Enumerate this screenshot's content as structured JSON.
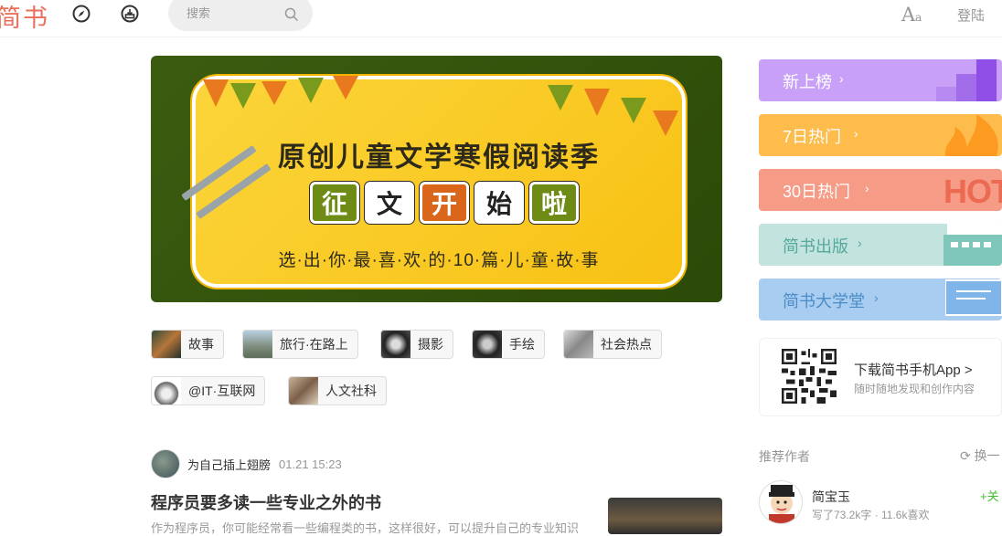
{
  "header": {
    "logo": "简书",
    "search_placeholder": "搜索",
    "font_toggle_big": "A",
    "font_toggle_small": "a",
    "login": "登陆"
  },
  "banner": {
    "title": "原创儿童文学寒假阅读季",
    "tiles": [
      "征",
      "文",
      "开",
      "始",
      "啦"
    ],
    "subtitle": "选·出·你·最·喜·欢·的·10·篇·儿·童·故·事"
  },
  "tags": [
    "故事",
    "旅行·在路上",
    "摄影",
    "手绘",
    "社会热点",
    "@IT·互联网",
    "人文社科"
  ],
  "post": {
    "author": "为自己插上翅膀",
    "time": "01.21 15:23",
    "title": "程序员要多读一些专业之外的书",
    "abstract": "作为程序员，你可能经常看一些编程类的书，这样很好，可以提升自己的专业知识"
  },
  "boards": [
    {
      "label": "新上榜",
      "chevron": "›",
      "color": "#c9a0f7"
    },
    {
      "label": "7日热门",
      "chevron": "›",
      "color": "#fdbc4b"
    },
    {
      "label": "30日热门",
      "chevron": "›",
      "color": "#f59b86"
    },
    {
      "label": "简书出版",
      "chevron": "›",
      "color": "#c2e3de"
    },
    {
      "label": "简书大学堂",
      "chevron": "›",
      "color": "#a9cdf0"
    }
  ],
  "board_decor": {
    "hot_text": "HOT"
  },
  "app_download": {
    "title": "下载简书手机App",
    "chevron": ">",
    "subtitle": "随时随地发现和创作内容"
  },
  "recommend": {
    "heading": "推荐作者",
    "swap": "换一",
    "swap_icon": "refresh-icon",
    "author_name": "简宝玉",
    "author_meta": "写了73.2k字 · 11.6k喜欢",
    "follow_label": "+关"
  },
  "colors": {
    "brand": "#ea6f5a",
    "follow": "#42c02e",
    "link_purple": "#7e3db1"
  }
}
